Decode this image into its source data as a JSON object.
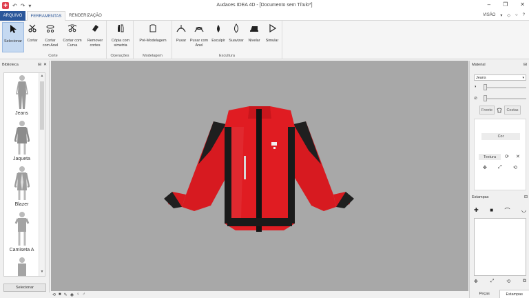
{
  "window": {
    "title": "Audaces IDEA 4D - [Documento sem Título*]",
    "controls": [
      "–",
      "❐",
      "✕"
    ]
  },
  "quick_access": {
    "app_icon": "audaces-logo-icon",
    "undo": "↶",
    "redo": "↷",
    "more": "▾"
  },
  "tabs": [
    {
      "label": "ARQUIVO"
    },
    {
      "label": "FERRAMENTAS"
    },
    {
      "label": "RENDERIZAÇÃO"
    }
  ],
  "view_menu": {
    "label": "VISÃO",
    "arrow": "▾",
    "icons": [
      "◇",
      "○",
      "?"
    ]
  },
  "ribbon": {
    "groups": [
      {
        "label": "Corte",
        "buttons": [
          {
            "label": "Selecionar",
            "icon": "cursor-icon",
            "active": true
          },
          {
            "label": "Cortar",
            "icon": "scissors-icon"
          },
          {
            "label": "Cortar\ncom Anel",
            "icon": "scissors-ring-icon"
          },
          {
            "label": "Cortar com\nCurva",
            "icon": "scissors-curve-icon"
          },
          {
            "label": "Remover\ncortes",
            "icon": "eraser-icon"
          }
        ]
      },
      {
        "label": "Operações",
        "buttons": [
          {
            "label": "Cópia com\nsimetria",
            "icon": "symmetry-icon"
          }
        ]
      },
      {
        "label": "Modelagem",
        "buttons": [
          {
            "label": "Pré-Modelagem",
            "icon": "premodel-icon"
          }
        ]
      },
      {
        "label": "Escultura",
        "buttons": [
          {
            "label": "Puxar",
            "icon": "pull-icon"
          },
          {
            "label": "Puxar com\nAnel",
            "icon": "pull-ring-icon"
          },
          {
            "label": "Esculpir",
            "icon": "sculpt-icon"
          },
          {
            "label": "Suavizar",
            "icon": "smooth-icon"
          },
          {
            "label": "Nivelar",
            "icon": "flatten-icon"
          },
          {
            "label": "Simular",
            "icon": "play-icon"
          }
        ]
      }
    ]
  },
  "library": {
    "title": "Biblioteca",
    "panel_icons": [
      "⊟",
      "✕"
    ],
    "items": [
      {
        "name": "Jeans"
      },
      {
        "name": "Jaqueta"
      },
      {
        "name": "Blazer"
      },
      {
        "name": "Camiseta A"
      }
    ],
    "select_button": "Selecionar"
  },
  "material": {
    "title": "Material",
    "panel_icons": [
      "⊟"
    ],
    "selected": "Jeans",
    "slider1_level": 0.0,
    "slider2_level": 0.0,
    "segments": [
      "Frente",
      "Costas"
    ],
    "color_button": "Cor",
    "texture_button": "Textura"
  },
  "stamps": {
    "title": "Estampas",
    "panel_icons": [
      "⊟"
    ]
  },
  "bottom_tabs": [
    "Peças",
    "Estampas"
  ],
  "colors": {
    "accent": "#2b579a",
    "garment": "#e01c22",
    "viewport": "#a8a8a8"
  }
}
